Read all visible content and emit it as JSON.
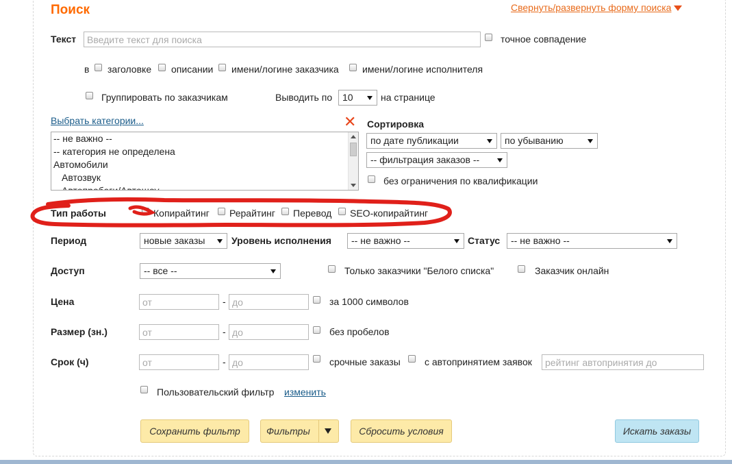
{
  "title": "Поиск",
  "toggle_form": "Свернуть/развернуть форму поиска",
  "text_search": {
    "label": "Текст",
    "placeholder": "Введите текст для поиска",
    "exact_match": "точное совпадение"
  },
  "search_in": {
    "prefix": "в",
    "options": [
      "заголовке",
      "описании",
      "имени/логине заказчика",
      "имени/логине исполнителя"
    ]
  },
  "grouping": {
    "group_by_customer": "Группировать по заказчикам",
    "per_page_label": "Выводить по",
    "per_page_value": "10",
    "per_page_suffix": "на странице"
  },
  "categories": {
    "select_link": "Выбрать категории...",
    "items": [
      "-- не важно --",
      "-- категория не определена",
      "Автомобили",
      "Автозвук",
      "Автопробеги/Автошоу"
    ]
  },
  "sorting": {
    "label": "Сортировка",
    "sort_by": "по дате публикации",
    "order": "по убыванию",
    "filter": "-- фильтрация заказов --",
    "no_qualification_limit": "без ограничения по квалификации"
  },
  "work_type": {
    "label": "Тип работы",
    "options": [
      "Копирайтинг",
      "Рерайтинг",
      "Перевод",
      "SEO-копирайтинг"
    ]
  },
  "period": {
    "label": "Период",
    "value": "новые заказы",
    "level_label": "Уровень исполнения",
    "level_value": "-- не важно --",
    "status_label": "Статус",
    "status_value": "-- не важно --"
  },
  "access": {
    "label": "Доступ",
    "value": "-- все --",
    "whitelist_only": "Только заказчики \"Белого списка\"",
    "customer_online": "Заказчик онлайн"
  },
  "price": {
    "label": "Цена",
    "from_placeholder": "от",
    "to_placeholder": "до",
    "per_1000": "за 1000 символов"
  },
  "size": {
    "label": "Размер (зн.)",
    "from_placeholder": "от",
    "to_placeholder": "до",
    "no_spaces": "без пробелов"
  },
  "deadline": {
    "label": "Срок (ч)",
    "from_placeholder": "от",
    "to_placeholder": "до",
    "urgent": "срочные заказы",
    "auto_accept": "с автопринятием заявок",
    "auto_accept_rating_placeholder": "рейтинг автопринятия до"
  },
  "dash": "-",
  "user_filter": {
    "label": "Пользовательский фильтр",
    "change_link": "изменить"
  },
  "buttons": {
    "save_filter": "Сохранить фильтр",
    "filters": "Фильтры",
    "reset": "Сбросить условия",
    "search": "Искать заказы"
  },
  "colors": {
    "title": "#ff6a00",
    "link": "#1a5c8a",
    "button_yellow": "#fdeaa8",
    "button_blue": "#bfe5f3",
    "annotation_red": "#e0201a"
  }
}
